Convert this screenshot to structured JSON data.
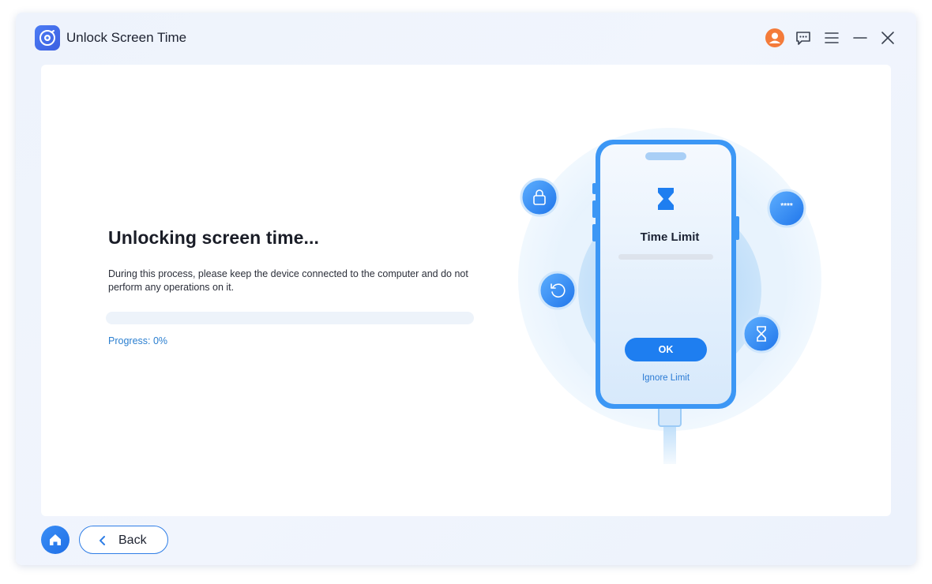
{
  "window": {
    "title": "Unlock Screen Time"
  },
  "titlebar": {
    "icons": [
      "user-avatar-icon",
      "chat-feedback-icon",
      "menu-icon",
      "minimize-icon",
      "close-icon"
    ]
  },
  "main": {
    "heading": "Unlocking screen time...",
    "description": "During this process, please keep the device connected to the computer and do not perform any operations on it.",
    "progress_label": "Progress: 0%",
    "progress_value": 0
  },
  "illustration": {
    "screen_title": "Time Limit",
    "ok_label": "OK",
    "ignore_label": "Ignore Limit",
    "passcode_badge": "****",
    "icons": [
      "lock-icon",
      "refresh-icon",
      "password-icon",
      "hourglass-icon"
    ]
  },
  "footer": {
    "back_label": "Back"
  },
  "colors": {
    "accent": "#1e7ef0",
    "brand": "#4b7cf5",
    "window_bg": "#eef3fc",
    "user_icon": "#f47b3a"
  }
}
